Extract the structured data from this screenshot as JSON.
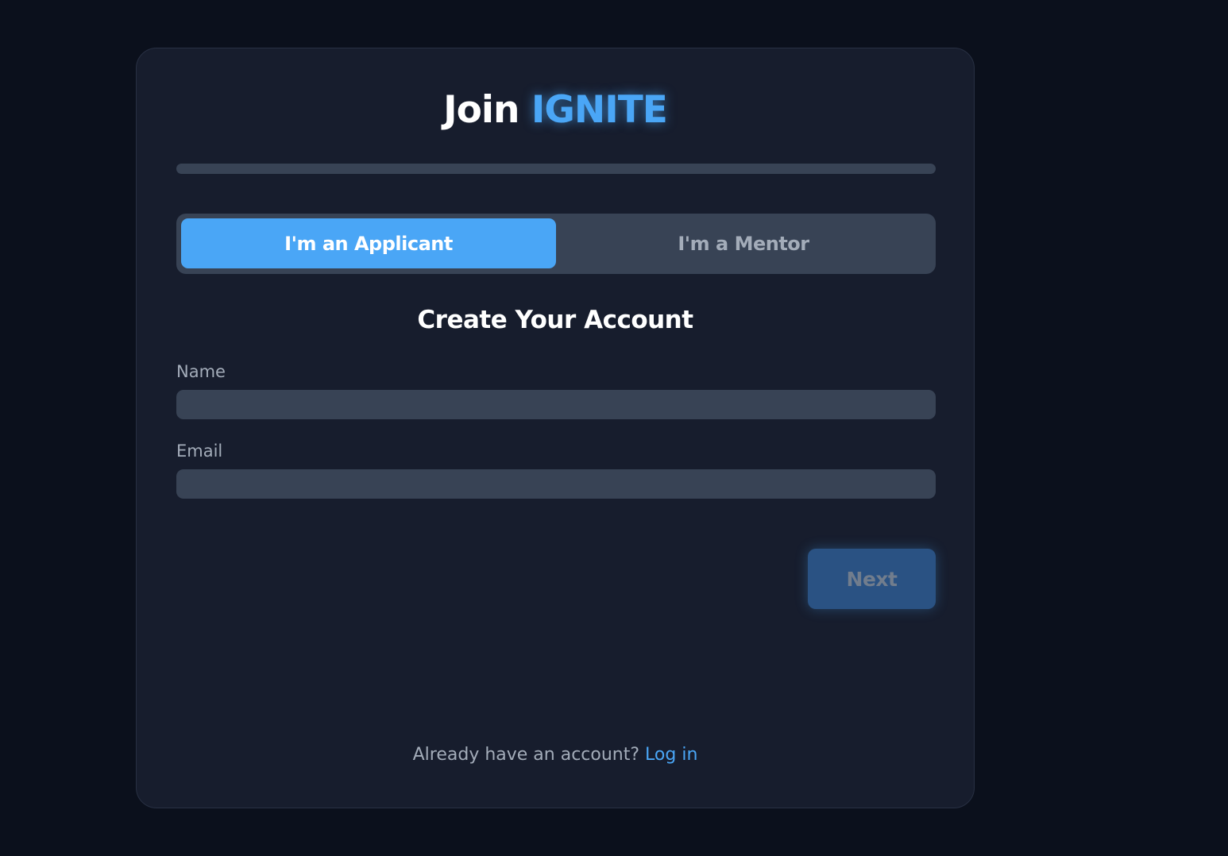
{
  "header": {
    "title_prefix": "Join",
    "brand": "IGNITE"
  },
  "progress": {
    "value": 0
  },
  "role_toggle": {
    "options": [
      {
        "label": "I'm an Applicant",
        "selected": true
      },
      {
        "label": "I'm a Mentor",
        "selected": false
      }
    ]
  },
  "form": {
    "heading": "Create Your Account",
    "fields": [
      {
        "label": "Name",
        "value": "",
        "placeholder": ""
      },
      {
        "label": "Email",
        "value": "",
        "placeholder": ""
      }
    ],
    "next_label": "Next",
    "next_disabled": true
  },
  "footer": {
    "prompt": "Already have an account?",
    "link_label": "Log in"
  },
  "colors": {
    "accent": "#4aa6f6",
    "background": "#0b101c",
    "card": "#171d2d",
    "input": "#384355"
  }
}
